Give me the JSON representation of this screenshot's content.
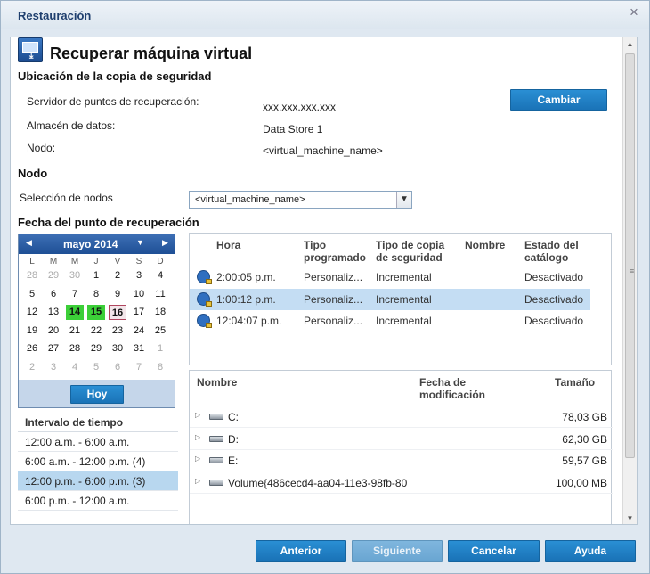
{
  "window": {
    "title": "Restauración",
    "close_glyph": "×"
  },
  "header": {
    "title": "Recuperar máquina virtual"
  },
  "backup_location": {
    "section_title": "Ubicación de la copia de seguridad",
    "server_label": "Servidor de puntos de recuperación:",
    "server_value": "xxx.xxx.xxx.xxx",
    "datastore_label": "Almacén de datos:",
    "datastore_value": "Data Store 1",
    "node_label": "Nodo:",
    "node_value": "<virtual_machine_name>",
    "change_button": "Cambiar"
  },
  "node": {
    "section_title": "Nodo",
    "selection_label": "Selección de nodos",
    "selected_value": "<virtual_machine_name>"
  },
  "recovery_date": {
    "section_title": "Fecha del punto de recuperación",
    "calendar": {
      "month_label": "mayo 2014",
      "weekdays": [
        "L",
        "M",
        "M",
        "J",
        "V",
        "S",
        "D"
      ],
      "weeks": [
        [
          "28",
          "29",
          "30",
          "1",
          "2",
          "3",
          "4"
        ],
        [
          "5",
          "6",
          "7",
          "8",
          "9",
          "10",
          "11"
        ],
        [
          "12",
          "13",
          "14",
          "15",
          "16",
          "17",
          "18"
        ],
        [
          "19",
          "20",
          "21",
          "22",
          "23",
          "24",
          "25"
        ],
        [
          "26",
          "27",
          "28",
          "29",
          "30",
          "31",
          "1"
        ],
        [
          "2",
          "3",
          "4",
          "5",
          "6",
          "7",
          "8"
        ]
      ],
      "today_button": "Hoy"
    },
    "interval": {
      "title": "Intervalo de tiempo",
      "items": [
        "12:00 a.m. - 6:00 a.m.",
        "6:00 a.m. - 12:00 p.m.   (4)",
        "12:00 p.m. - 6:00 p.m.   (3)",
        "6:00 p.m. - 12:00 a.m."
      ]
    }
  },
  "recovery_points": {
    "headers": [
      "Hora",
      "Tipo programado",
      "Tipo de copia de seguridad",
      "Nombre",
      "Estado del catálogo"
    ],
    "header_lines": [
      [
        "Hora"
      ],
      [
        "Tipo",
        "programado"
      ],
      [
        "Tipo de copia",
        "de seguridad"
      ],
      [
        "Nombre"
      ],
      [
        "Estado del",
        "catálogo"
      ]
    ],
    "rows": [
      {
        "time": "2:00:05 p.m.",
        "scheduled": "Personaliz...",
        "backup_type": "Incremental",
        "name": "",
        "catalog": "Desactivado"
      },
      {
        "time": "1:00:12 p.m.",
        "scheduled": "Personaliz...",
        "backup_type": "Incremental",
        "name": "",
        "catalog": "Desactivado"
      },
      {
        "time": "12:04:07 p.m.",
        "scheduled": "Personaliz...",
        "backup_type": "Incremental",
        "name": "",
        "catalog": "Desactivado"
      }
    ]
  },
  "file_tree": {
    "headers": {
      "name": "Nombre",
      "modified_line1": "Fecha de",
      "modified_line2": "modificación",
      "size": "Tamaño"
    },
    "rows": [
      {
        "name": "C:",
        "size": "78,03 GB"
      },
      {
        "name": "D:",
        "size": "62,30 GB"
      },
      {
        "name": "E:",
        "size": "59,57 GB"
      },
      {
        "name": "Volume{486cecd4-aa04-11e3-98fb-80",
        "size": "100,00 MB"
      }
    ]
  },
  "footer": {
    "back": "Anterior",
    "next": "Siguiente",
    "cancel": "Cancelar",
    "help": "Ayuda"
  },
  "icons": {
    "window_close": "close-icon",
    "header": "restore-vm-icon",
    "calendar_prev": "triangle-left-icon",
    "calendar_next": "triangle-right-icon",
    "calendar_month_menu": "triangle-down-icon",
    "select_dropdown": "chevron-down-icon",
    "recovery_point": "clock-lock-icon",
    "tree_expand": "triangle-right-icon",
    "disk": "hard-disk-icon"
  },
  "colors": {
    "accent": "#1a73b7",
    "selected_row": "#c4ddf3",
    "backup_day": "#3ccf38"
  },
  "calendar_state": {
    "green_days": [
      "14",
      "15"
    ],
    "today": "16"
  }
}
